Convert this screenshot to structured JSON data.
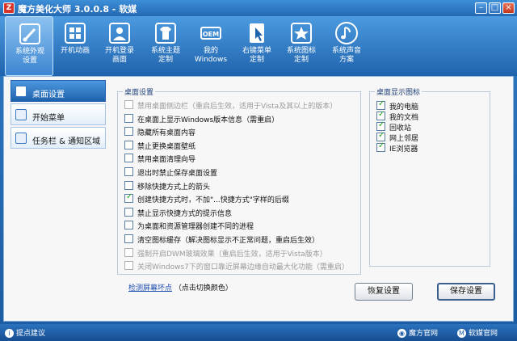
{
  "window": {
    "title": "魔方美化大师 3.0.0.8 - 软媒"
  },
  "toolbar": {
    "items": [
      {
        "label": "系统外观\n设置",
        "icon": "brush-icon"
      },
      {
        "label": "开机动画",
        "icon": "windows-logo-icon"
      },
      {
        "label": "开机登录\n画面",
        "icon": "user-login-icon"
      },
      {
        "label": "系统主题\n定制",
        "icon": "shirt-icon"
      },
      {
        "label": "我的\nWindows",
        "icon": "oem-icon"
      },
      {
        "label": "右键菜单\n定制",
        "icon": "cursor-menu-icon"
      },
      {
        "label": "系统图标\n定制",
        "icon": "star-icon"
      },
      {
        "label": "系统声音\n方案",
        "icon": "music-note-icon"
      }
    ]
  },
  "sidebar": {
    "items": [
      {
        "label": "桌面设置"
      },
      {
        "label": "开始菜单"
      },
      {
        "label": "任务栏 & 通知区域"
      }
    ]
  },
  "desktop_settings": {
    "title": "桌面设置",
    "options": [
      {
        "label": "禁用桌面侧边栏（重启后生效，适用于Vista及其以上的版本）",
        "checked": false,
        "disabled": true
      },
      {
        "label": "在桌面上显示Windows版本信息（需重启）",
        "checked": false,
        "disabled": false
      },
      {
        "label": "隐藏所有桌面内容",
        "checked": false,
        "disabled": false
      },
      {
        "label": "禁止更换桌面壁纸",
        "checked": false,
        "disabled": false
      },
      {
        "label": "禁用桌面清理向导",
        "checked": false,
        "disabled": false
      },
      {
        "label": "退出时禁止保存桌面设置",
        "checked": false,
        "disabled": false
      },
      {
        "label": "移除快捷方式上的箭头",
        "checked": false,
        "disabled": false
      },
      {
        "label": "创建快捷方式时，不加\"...快捷方式\"字样的后缀",
        "checked": true,
        "disabled": false
      },
      {
        "label": "禁止显示快捷方式的提示信息",
        "checked": false,
        "disabled": false
      },
      {
        "label": "为桌面和资源管理器创建不同的进程",
        "checked": false,
        "disabled": false
      },
      {
        "label": "清空图标缓存（解决图标显示不正常问题，重启后生效）",
        "checked": false,
        "disabled": false
      },
      {
        "label": "强制开启DWM玻璃效果（重启后生效，适用于Vista版本）",
        "checked": false,
        "disabled": true
      },
      {
        "label": "关闭Windows7下的窗口靠近屏幕边缘自动最大化功能（需重启）",
        "checked": false,
        "disabled": true
      }
    ]
  },
  "desktop_icons": {
    "title": "桌面显示图标",
    "items": [
      {
        "label": "我的电脑",
        "checked": true
      },
      {
        "label": "我的文档",
        "checked": true
      },
      {
        "label": "回收站",
        "checked": true
      },
      {
        "label": "网上邻居",
        "checked": true
      },
      {
        "label": "IE浏览器",
        "checked": true
      }
    ]
  },
  "detect": {
    "link": "检测屏幕坏点",
    "hint": "（点击切换颜色）"
  },
  "buttons": {
    "restore": "恢复设置",
    "save": "保存设置"
  },
  "statusbar": {
    "suggest": "提点建议",
    "official": "魔方官网",
    "ruanmei": "软媒官网"
  }
}
